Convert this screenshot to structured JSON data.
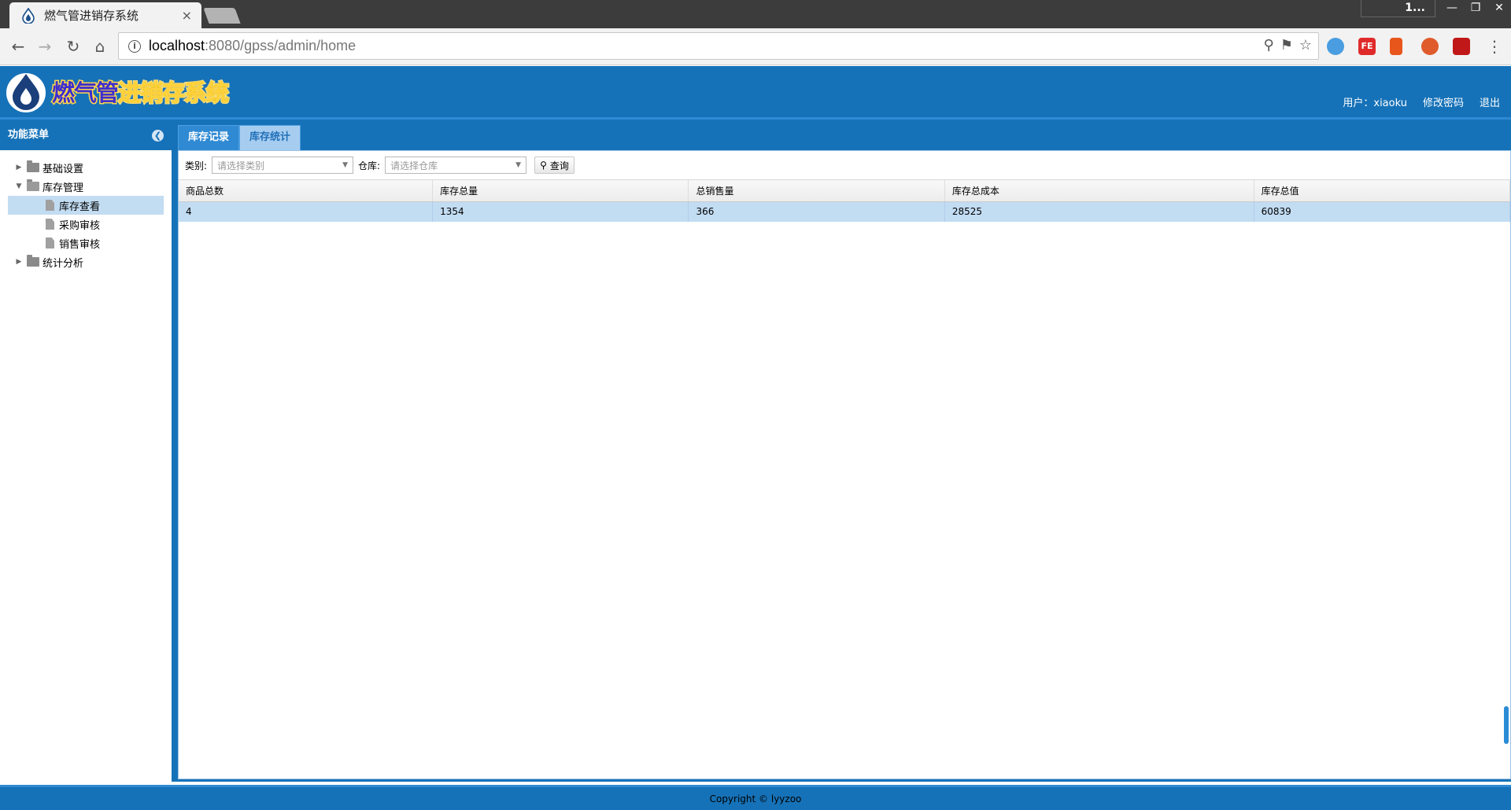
{
  "browser": {
    "tab_title": "燃气管进销存系统",
    "tab_close": "×",
    "profile": "1...",
    "url_host": "localhost",
    "url_path": ":8080/gpss/admin/home",
    "ext_fe": "FE"
  },
  "app": {
    "logo_parts": [
      "燃气管",
      "进销存系统"
    ],
    "header_links": {
      "user": "用户：xiaoku",
      "change_password": "修改密码",
      "logout": "退出"
    },
    "sidebar": {
      "title": "功能菜单",
      "tree": [
        {
          "label": "基础设置",
          "level": 0,
          "type": "folder",
          "expanded": false
        },
        {
          "label": "库存管理",
          "level": 0,
          "type": "folder",
          "expanded": true
        },
        {
          "label": "库存查看",
          "level": 1,
          "type": "file",
          "selected": true
        },
        {
          "label": "采购审核",
          "level": 1,
          "type": "file"
        },
        {
          "label": "销售审核",
          "level": 1,
          "type": "file"
        },
        {
          "label": "统计分析",
          "level": 0,
          "type": "folder",
          "expanded": false
        }
      ]
    },
    "tabs": [
      {
        "label": "库存记录",
        "active": false
      },
      {
        "label": "库存统计",
        "active": true
      }
    ],
    "filter": {
      "category_label": "类别:",
      "category_placeholder": "请选择类别",
      "warehouse_label": "仓库:",
      "warehouse_placeholder": "请选择仓库",
      "query_label": "查询"
    },
    "table": {
      "columns": [
        "商品总数",
        "库存总量",
        "总销售量",
        "库存总成本",
        "库存总值"
      ],
      "rows": [
        [
          "4",
          "1354",
          "366",
          "28525",
          "60839"
        ]
      ]
    },
    "footer": "Copyright © lyyzoo"
  },
  "colors": {
    "primary": "#1672b8",
    "selected_row": "#c2dcf2"
  }
}
